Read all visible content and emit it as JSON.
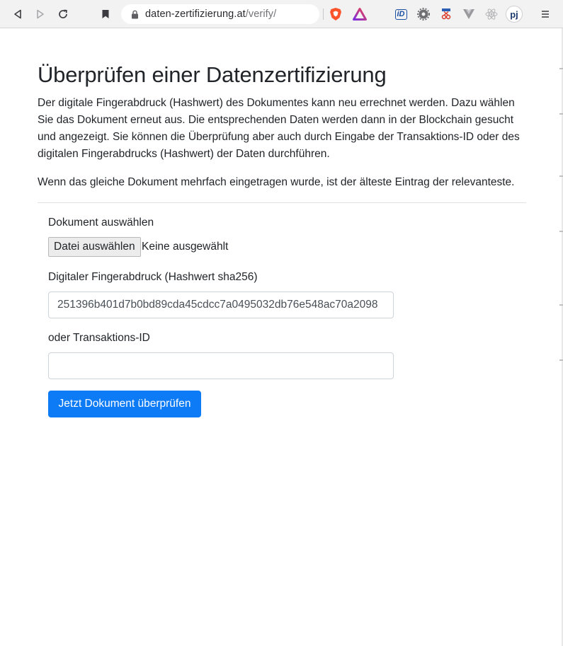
{
  "browser": {
    "url_host": "daten-zertifizierung.at",
    "url_path": "/verify/",
    "ext_labels": [
      "iD",
      "pj"
    ],
    "brand_colors": {
      "brave": "#fb542b",
      "accent": "#0d7bf6"
    }
  },
  "page": {
    "title": "Überprüfen einer Datenzertifizierung",
    "lead": "Der digitale Fingerabdruck (Hashwert) des Dokumentes kann neu errechnet werden. Dazu wählen Sie das Dokument erneut aus. Die entsprechenden Daten werden dann in der Blockchain gesucht und angezeigt. Sie können die Überprüfung aber auch durch Eingabe der Transaktions-ID oder des digitalen Fingerabdrucks (Hashwert) der Daten durchführen.",
    "note": "Wenn das gleiche Dokument mehrfach eingetragen wurde, ist der älteste Eintrag der relevanteste."
  },
  "form": {
    "file_label": "Dokument auswählen",
    "file_button": "Datei auswählen",
    "file_status": "Keine ausgewählt",
    "hash_label": "Digitaler Fingerabdruck (Hashwert sha256)",
    "hash_value": "251396b401d7b0bd89cda45cdcc7a0495032db76e548ac70a2098",
    "txid_label": "oder Transaktions-ID",
    "txid_value": "",
    "submit_label": "Jetzt Dokument überprüfen"
  }
}
